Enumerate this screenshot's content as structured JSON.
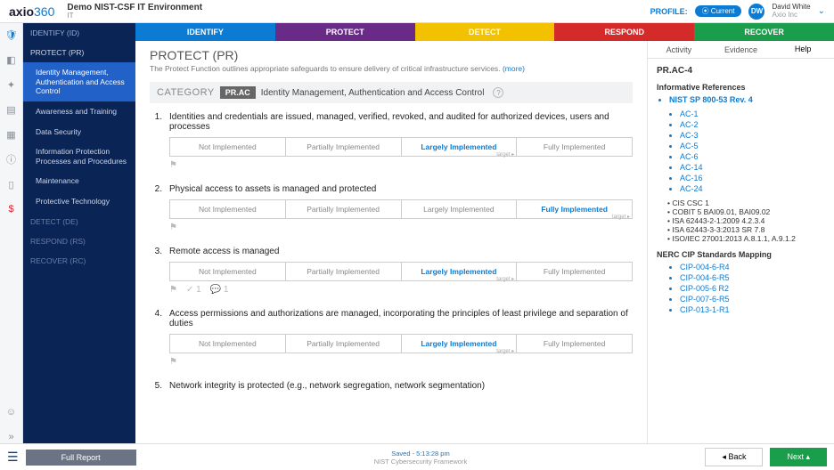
{
  "top": {
    "logo_a": "axio",
    "logo_b": "360",
    "env_name": "Demo NIST-CSF IT Environment",
    "env_sub": "IT",
    "profile_label": "PROFILE:",
    "profile_pill": "⦿ Current",
    "avatar": "DW",
    "user_name": "David White",
    "user_org": "Axio Inc"
  },
  "iconrail": [
    "shield",
    "dashboard",
    "chart",
    "doc",
    "grid",
    "info",
    "file",
    "alert"
  ],
  "leftnav": {
    "identify": "IDENTIFY (ID)",
    "protect": "PROTECT (PR)",
    "items": [
      "Identity Management, Authentication and Access Control",
      "Awareness and Training",
      "Data Security",
      "Information Protection Processes and Procedures",
      "Maintenance",
      "Protective Technology"
    ],
    "detect": "DETECT (DE)",
    "respond": "RESPOND (RS)",
    "recover": "RECOVER (RC)"
  },
  "functions": {
    "identify": "IDENTIFY",
    "protect": "PROTECT",
    "detect": "DETECT",
    "respond": "RESPOND",
    "recover": "RECOVER"
  },
  "tabs": {
    "activity": "Activity",
    "evidence": "Evidence",
    "help": "Help"
  },
  "page": {
    "title": "PROTECT (PR)",
    "desc": "The Protect Function outlines appropriate safeguards to ensure delivery of critical infrastructure services.",
    "more": "(more)",
    "cat_label": "CATEGORY",
    "cat_code": "PR.AC",
    "cat_name": "Identity Management, Authentication and Access Control"
  },
  "opts": [
    "Not Implemented",
    "Partially Implemented",
    "Largely Implemented",
    "Fully Implemented"
  ],
  "questions": [
    {
      "n": "1.",
      "t": "Identities and credentials are issued, managed, verified, revoked, and audited for authorized devices, users and processes",
      "sel": 2
    },
    {
      "n": "2.",
      "t": "Physical access to assets is managed and protected",
      "sel": 3
    },
    {
      "n": "3.",
      "t": "Remote access is managed",
      "sel": 2,
      "flags": true
    },
    {
      "n": "4.",
      "t": "Access permissions and authorizations are managed, incorporating the principles of least privilege and separation of duties",
      "sel": 2
    },
    {
      "n": "5.",
      "t": "Network integrity is protected (e.g., network segregation, network segmentation)",
      "sel": -1
    }
  ],
  "right": {
    "code": "PR.AC-4",
    "ref_title": "Informative References",
    "nist_title": "NIST SP 800-53 Rev. 4",
    "nist": [
      "AC-1",
      "AC-2",
      "AC-3",
      "AC-5",
      "AC-6",
      "AC-14",
      "AC-16",
      "AC-24"
    ],
    "others": [
      "CIS CSC 1",
      "COBIT 5 BAI09.01, BAI09.02",
      "ISA 62443-2-1:2009 4.2.3.4",
      "ISA 62443-3-3:2013 SR 7.8",
      "ISO/IEC 27001:2013 A.8.1.1, A.9.1.2"
    ],
    "nerc_title": "NERC CIP Standards Mapping",
    "nerc": [
      "CIP-004-6-R4",
      "CIP-004-6-R5",
      "CIP-005-6 R2",
      "CIP-007-6-R5",
      "CIP-013-1-R1"
    ]
  },
  "footer": {
    "full_report": "Full Report",
    "saved": "Saved - 5:13:28 pm",
    "framework": "NIST Cybersecurity Framework",
    "back": "Back",
    "next": "Next"
  }
}
